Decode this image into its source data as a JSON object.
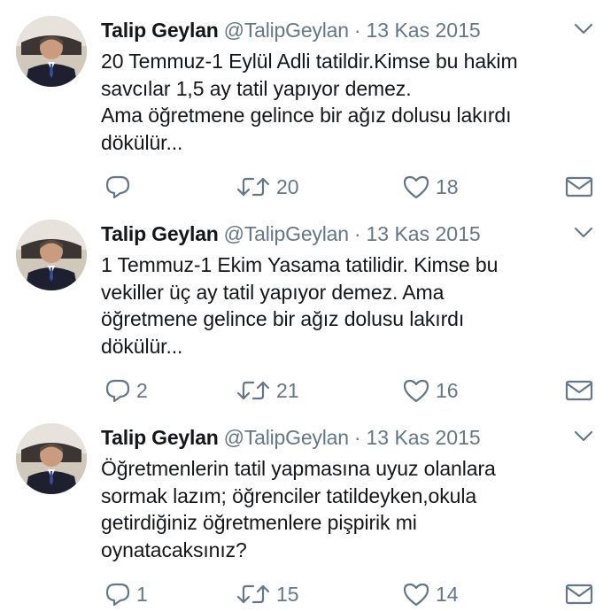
{
  "tweets": [
    {
      "name": "Talip Geylan",
      "handle": "@TalipGeylan",
      "separator": "·",
      "date": "13 Kas 2015",
      "text": "20 Temmuz-1 Eylül Adli tatildir.Kimse bu hakim\nsavcılar 1,5 ay tatil yapıyor demez.\nAma öğretmene gelince bir ağız dolusu lakırdı\ndökülür...",
      "replies": "",
      "retweets": "20",
      "likes": "18",
      "icons": [
        "avatar-photo",
        "chevron-down-icon",
        "reply-icon",
        "retweet-icon",
        "heart-icon",
        "envelope-icon"
      ]
    },
    {
      "name": "Talip Geylan",
      "handle": "@TalipGeylan",
      "separator": "·",
      "date": "13 Kas 2015",
      "text": "1 Temmuz-1 Ekim Yasama tatilidir. Kimse bu\nvekiller üç ay tatil yapıyor demez. Ama\nöğretmene gelince bir ağız dolusu lakırdı\ndökülür...",
      "replies": "2",
      "retweets": "21",
      "likes": "16",
      "icons": [
        "avatar-photo",
        "chevron-down-icon",
        "reply-icon",
        "retweet-icon",
        "heart-icon",
        "envelope-icon"
      ]
    },
    {
      "name": "Talip Geylan",
      "handle": "@TalipGeylan",
      "separator": "·",
      "date": "13 Kas 2015",
      "text": "Öğretmenlerin tatil yapmasına uyuz olanlara\nsormak lazım; öğrenciler tatildeyken,okula\ngetirdiğiniz öğretmenlere pişpirik mi\noynatacaksınız?",
      "replies": "1",
      "retweets": "15",
      "likes": "14",
      "icons": [
        "avatar-photo",
        "chevron-down-icon",
        "reply-icon",
        "retweet-icon",
        "heart-icon",
        "envelope-icon"
      ]
    }
  ],
  "colors": {
    "text": "#14171a",
    "secondary": "#657786",
    "background": "#ffffff"
  }
}
